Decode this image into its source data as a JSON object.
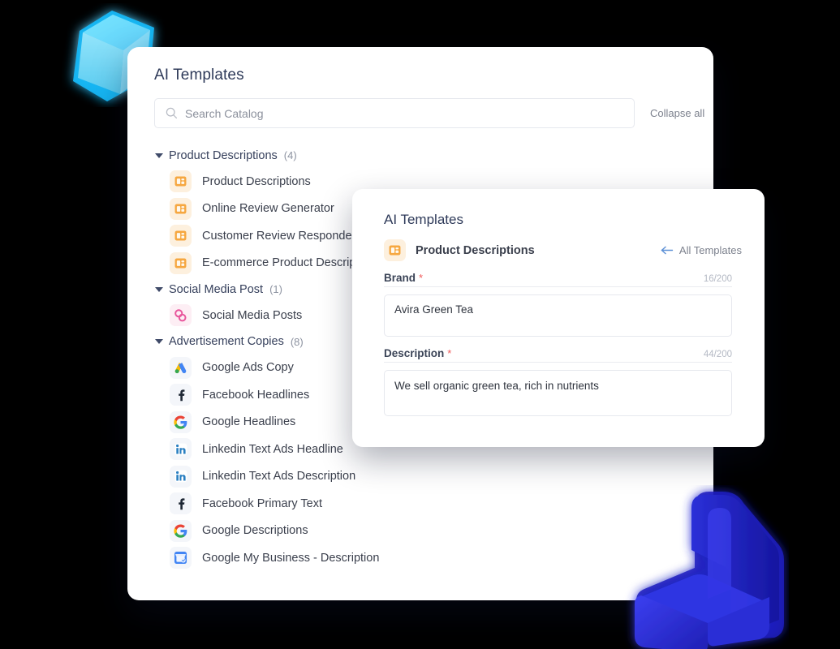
{
  "catalog": {
    "title": "AI Templates",
    "search": {
      "placeholder": "Search Catalog",
      "value": ""
    },
    "collapse_all_label": "Collapse all",
    "groups": [
      {
        "name": "Product Descriptions",
        "count": "(4)",
        "caret_icon": "caret-down-icon",
        "items": [
          {
            "label": "Product Descriptions",
            "icon": "product-description-icon",
            "icon_kind": "prod"
          },
          {
            "label": "Online Review Generator",
            "icon": "product-description-icon",
            "icon_kind": "prod"
          },
          {
            "label": "Customer Review Responder",
            "icon": "product-description-icon",
            "icon_kind": "prod"
          },
          {
            "label": "E-commerce Product Descrip",
            "icon": "product-description-icon",
            "icon_kind": "prod"
          }
        ]
      },
      {
        "name": "Social Media Post",
        "count": "(1)",
        "caret_icon": "caret-down-icon",
        "items": [
          {
            "label": "Social Media Posts",
            "icon": "social-media-icon",
            "icon_kind": "soc"
          }
        ]
      },
      {
        "name": "Advertisement Copies",
        "count": "(8)",
        "caret_icon": "caret-down-icon",
        "items": [
          {
            "label": "Google Ads Copy",
            "icon": "google-ads-icon",
            "icon_kind": "gads"
          },
          {
            "label": "Facebook Headlines",
            "icon": "facebook-icon",
            "icon_kind": "fb"
          },
          {
            "label": "Google Headlines",
            "icon": "google-icon",
            "icon_kind": "google"
          },
          {
            "label": "Linkedin Text Ads Headline",
            "icon": "linkedin-icon",
            "icon_kind": "li"
          },
          {
            "label": "Linkedin Text Ads Description",
            "icon": "linkedin-icon",
            "icon_kind": "li"
          },
          {
            "label": "Facebook Primary Text",
            "icon": "facebook-icon",
            "icon_kind": "fb"
          },
          {
            "label": "Google Descriptions",
            "icon": "google-icon",
            "icon_kind": "google"
          },
          {
            "label": "Google My Business - Description",
            "icon": "google-my-business-icon",
            "icon_kind": "gmb"
          }
        ]
      }
    ]
  },
  "detail": {
    "title": "AI Templates",
    "template_name": "Product Descriptions",
    "template_icon": "product-description-icon",
    "back_link_label": "All Templates",
    "back_icon": "arrow-left-icon",
    "fields": [
      {
        "label": "Brand",
        "required_marker": "*",
        "counter": "16/200",
        "value": "Avira Green Tea",
        "placeholder": ""
      },
      {
        "label": "Description",
        "required_marker": "*",
        "counter": "44/200",
        "value": "We sell organic green tea, rich in nutrients",
        "placeholder": ""
      }
    ]
  },
  "decor": {
    "cube": "cyan-glass-cube",
    "bracket": "blue-l-bracket"
  },
  "colors": {
    "background": "#000000",
    "card": "#ffffff",
    "title_text": "#2e3a59",
    "body_text": "#3a3f4c",
    "muted_text": "#7c818d",
    "required_star": "#f05a5a",
    "border": "#e6e8ee",
    "cube_cyan": "#22c8ff",
    "bracket_blue": "#2a2fd6"
  }
}
